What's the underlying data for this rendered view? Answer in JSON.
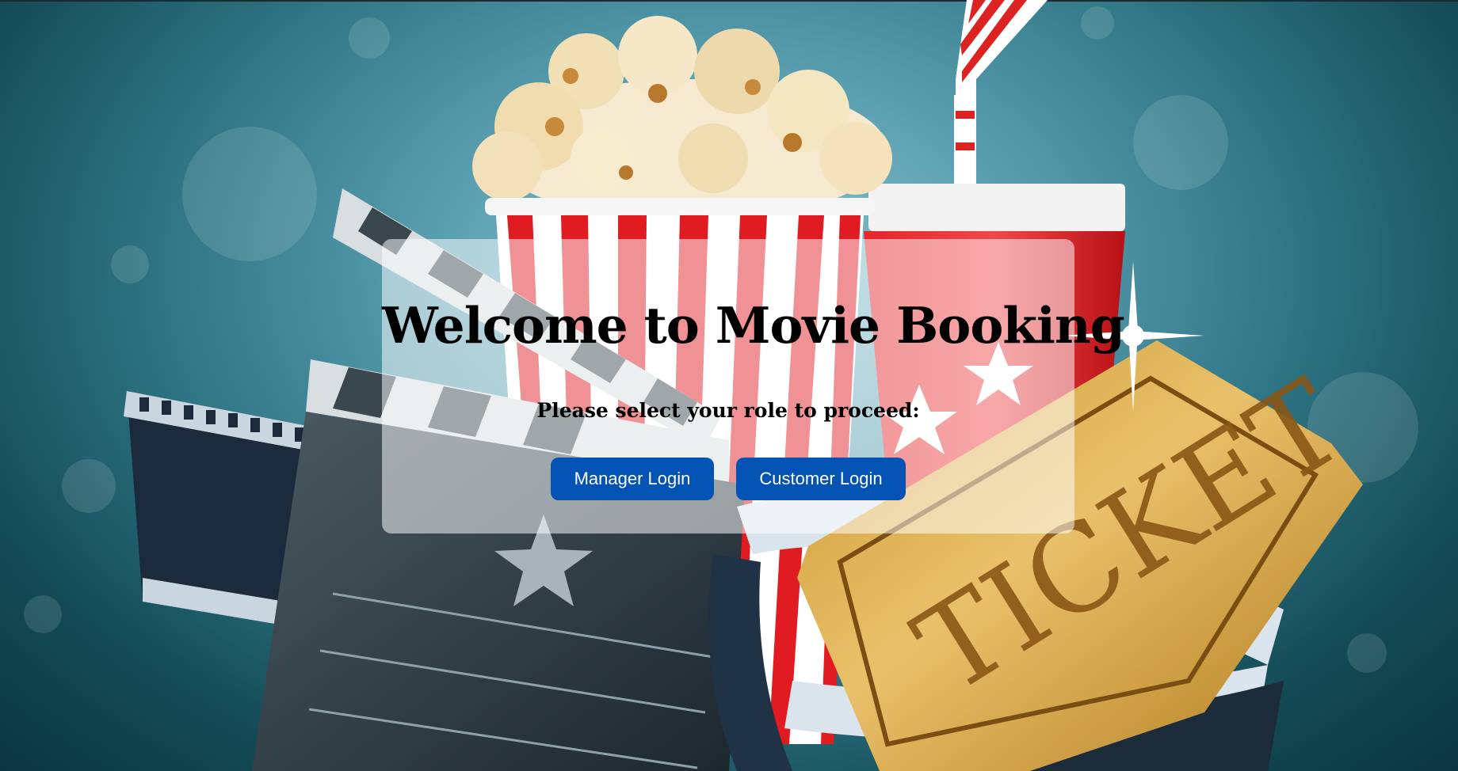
{
  "hero": {
    "title": "Welcome to Movie Booking",
    "subtitle": "Please select your role to proceed:",
    "ticket_text": "TICKET"
  },
  "buttons": {
    "manager_label": "Manager Login",
    "customer_label": "Customer Login"
  },
  "colors": {
    "button_bg": "#0353b4",
    "background_teal": "#2f7584",
    "card_overlay": "rgba(255,255,255,0.52)"
  },
  "icons": [
    "popcorn-icon",
    "soda-cup-icon",
    "clapperboard-icon",
    "film-reel-icon",
    "ticket-icon",
    "star-icon"
  ]
}
